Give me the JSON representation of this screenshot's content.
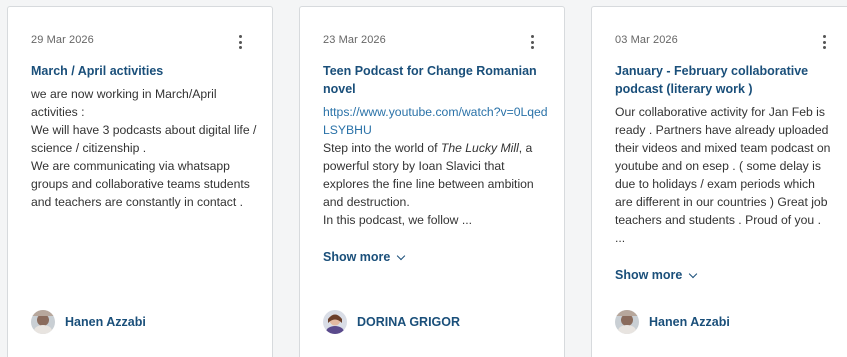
{
  "cards": [
    {
      "date": "29 Mar 2026",
      "title": "March / April activities",
      "body": [
        "we are now working in March/April activities :",
        "We will have 3 podcasts about digital life / science / citizenship .",
        "We are communicating via whatsapp groups and collaborative teams students and teachers are constantly in contact ."
      ],
      "author": "Hanen Azzabi"
    },
    {
      "date": "23 Mar 2026",
      "title": "Teen Podcast for Change Romanian novel",
      "link": "https://www.youtube.com/watch?v=0LqedLSYBHU",
      "body_pre": "Step into the world of ",
      "body_em": "The Lucky Mill",
      "body_post": ", a powerful story by Ioan Slavici that explores the fine line between ambition and destruction.",
      "body_line2": "In this podcast, we follow ...",
      "show_more": "Show more",
      "author": "DORINA GRIGOR"
    },
    {
      "date": "03 Mar 2026",
      "title": "January - February collaborative podcast (literary work )",
      "body": "Our collaborative activity for Jan Feb is ready . Partners have already uploaded their videos and mixed team podcast on youtube and on esep . ( some delay is due to holidays / exam periods which are different in our countries ) Great job teachers and students . Proud of you .",
      "ellipsis": "...",
      "show_more": "Show more",
      "author": "Hanen Azzabi"
    }
  ],
  "icons": {
    "menu": "more-vertical-icon",
    "expand": "chevron-down-icon"
  },
  "colors": {
    "accent": "#1a4f7a",
    "link": "#2a72a8",
    "text": "#333333",
    "muted": "#666666",
    "border": "#d7dadd",
    "background": "#f4f5f6"
  }
}
